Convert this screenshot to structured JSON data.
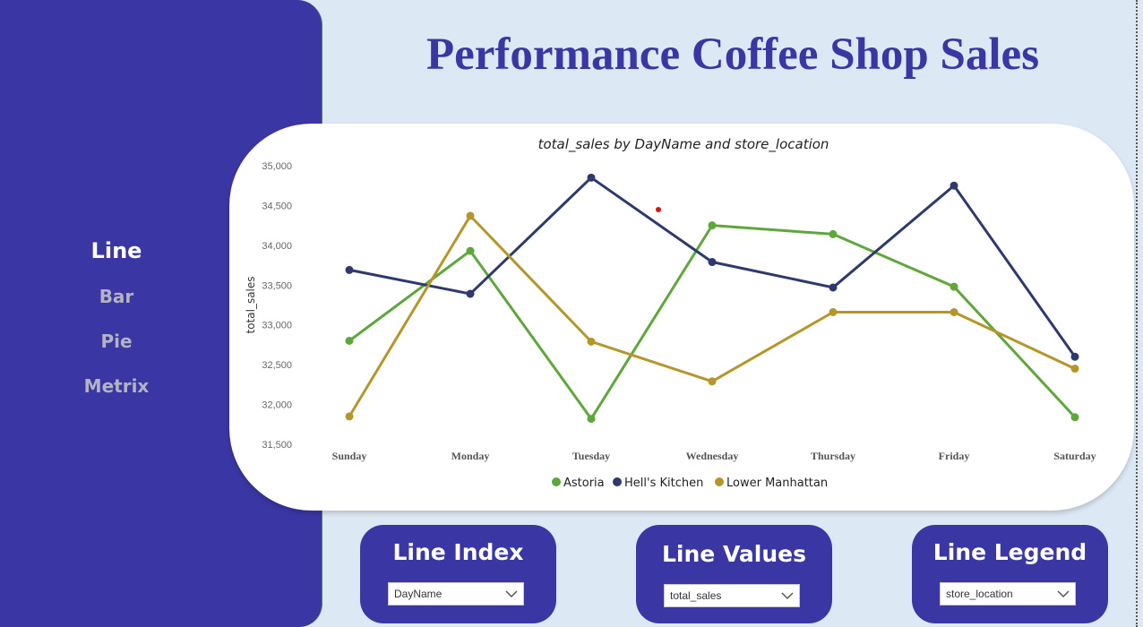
{
  "sidebar": {
    "items": [
      {
        "label": "Line",
        "active": true
      },
      {
        "label": "Bar",
        "active": false
      },
      {
        "label": "Pie",
        "active": false
      },
      {
        "label": "Metrix",
        "active": false
      }
    ]
  },
  "page_title": "Performance Coffee Shop Sales",
  "controls": [
    {
      "title": "Line Index",
      "value": "DayName",
      "icon": "chevron-down-icon"
    },
    {
      "title": "Line Values",
      "value": "total_sales",
      "icon": "chevron-down-icon"
    },
    {
      "title": "Line Legend",
      "value": "store_location",
      "icon": "chevron-down-icon"
    }
  ],
  "colors": {
    "accent": "#3a37a4",
    "background": "#dde8f5",
    "astoria": "#5ea73b",
    "hells_kitchen": "#2e3a6e",
    "lower_manhattan": "#b6952b"
  },
  "chart_data": {
    "type": "line",
    "title": "total_sales by DayName and store_location",
    "xlabel": "",
    "ylabel": "total_sales",
    "categories": [
      "Sunday",
      "Monday",
      "Tuesday",
      "Wednesday",
      "Thursday",
      "Friday",
      "Saturday"
    ],
    "ylim": [
      31500,
      35000
    ],
    "yticks": [
      "31,500",
      "32,000",
      "32,500",
      "33,000",
      "33,500",
      "34,000",
      "34,500",
      "35,000"
    ],
    "grid": false,
    "legend_position": "bottom",
    "series": [
      {
        "name": "Astoria",
        "color": "#5ea73b",
        "values": [
          32800,
          33930,
          31820,
          34250,
          34140,
          33480,
          31840
        ]
      },
      {
        "name": "Hell's Kitchen",
        "color": "#2e3a6e",
        "values": [
          33690,
          33390,
          34850,
          33790,
          33470,
          34750,
          32600
        ]
      },
      {
        "name": "Lower Manhattan",
        "color": "#b6952b",
        "values": [
          31850,
          34370,
          32790,
          32290,
          33160,
          33160,
          32450
        ]
      }
    ]
  }
}
